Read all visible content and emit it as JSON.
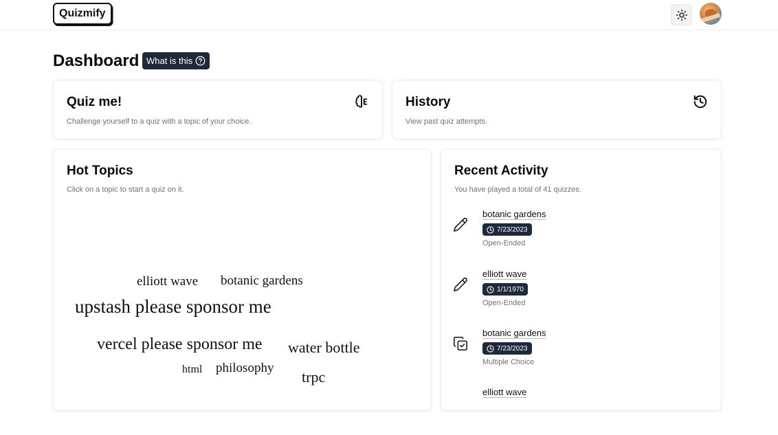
{
  "header": {
    "logo": "Quizmify"
  },
  "icons": {
    "theme": "sun-icon",
    "avatar": "user-avatar"
  },
  "page": {
    "title": "Dashboard",
    "what_is_this": "What is this"
  },
  "quiz_card": {
    "title": "Quiz me!",
    "description": "Challenge yourself to a quiz with a topic of your choice.",
    "icon": "brain-icon"
  },
  "history_card": {
    "title": "History",
    "description": "View past quiz attempts.",
    "icon": "history-icon"
  },
  "hot_topics": {
    "title": "Hot Topics",
    "description": "Click on a topic to start a quiz on it.",
    "topics": [
      "elliott wave",
      "botanic gardens",
      "upstash please sponsor me",
      "vercel please sponsor me",
      "water bottle",
      "html",
      "philosophy",
      "trpc"
    ]
  },
  "recent_activity": {
    "title": "Recent Activity",
    "description": "You have played a total of 41 quizzes.",
    "items": [
      {
        "topic": "botanic gardens",
        "date": "7/23/2023",
        "type": "Open-Ended",
        "icon": "pencil-icon"
      },
      {
        "topic": "elliott wave",
        "date": "1/1/1970",
        "type": "Open-Ended",
        "icon": "pencil-icon"
      },
      {
        "topic": "botanic gardens",
        "date": "7/23/2023",
        "type": "Multiple Choice",
        "icon": "copy-check-icon"
      },
      {
        "topic": "elliott wave"
      }
    ]
  },
  "colors": {
    "badge_bg": "#1e293b",
    "muted_text": "#71717a",
    "border": "#ececec"
  }
}
